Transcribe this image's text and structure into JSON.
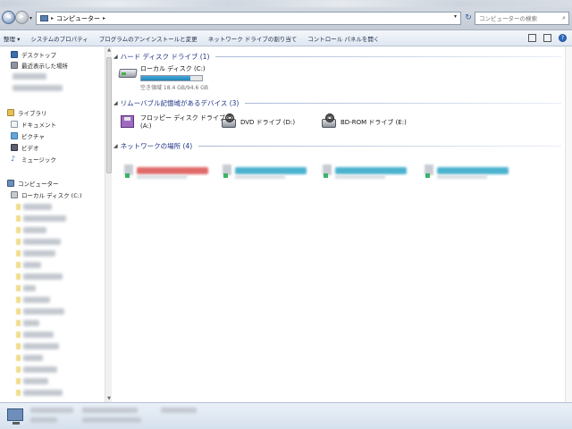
{
  "address": {
    "crumb": "コンピューター",
    "separator": "▸"
  },
  "search": {
    "placeholder": "コンピューターの検索"
  },
  "toolbar": {
    "items": [
      "整理 ▾",
      "システムのプロパティ",
      "プログラムのアンインストールと変更",
      "ネットワーク ドライブの割り当て",
      "コントロール パネルを開く"
    ]
  },
  "sidebar": {
    "favorites": [
      {
        "label": "デスクトップ",
        "icon": "desktop-icon"
      },
      {
        "label": "最近表示した場所",
        "icon": "recent-places-icon"
      }
    ],
    "libraries": {
      "label": "ライブラリ",
      "items": [
        {
          "label": "ドキュメント",
          "icon": "documents-icon"
        },
        {
          "label": "ピクチャ",
          "icon": "pictures-icon"
        },
        {
          "label": "ビデオ",
          "icon": "videos-icon"
        },
        {
          "label": "ミュージック",
          "icon": "music-icon"
        }
      ]
    },
    "computer": {
      "label": "コンピューター",
      "local_disk": "ローカル ディスク (C:)"
    }
  },
  "main": {
    "hdd_group": {
      "title": "ハード ディスク ドライブ (1)",
      "drives": [
        {
          "name": "ローカル ディスク (C:)",
          "info": "空き領域 18.4 GB/94.6 GB",
          "used_fraction": 0.81
        }
      ]
    },
    "removable_group": {
      "title": "リムーバブル記憶域があるデバイス (3)",
      "drives": [
        {
          "name": "フロッピー ディスク ドライブ",
          "letter": "(A:)",
          "icon": "floppy-drive-icon"
        },
        {
          "name": "DVD ドライブ (D:)",
          "icon": "dvd-drive-icon"
        },
        {
          "name": "BD-ROM ドライブ (E:)",
          "icon": "bd-rom-drive-icon"
        }
      ]
    },
    "network_group": {
      "title": "ネットワークの場所 (4)",
      "bar_colors": [
        "#e06a6a",
        "#4bb2cf",
        "#4bb2cf",
        "#4bb2cf"
      ]
    }
  }
}
